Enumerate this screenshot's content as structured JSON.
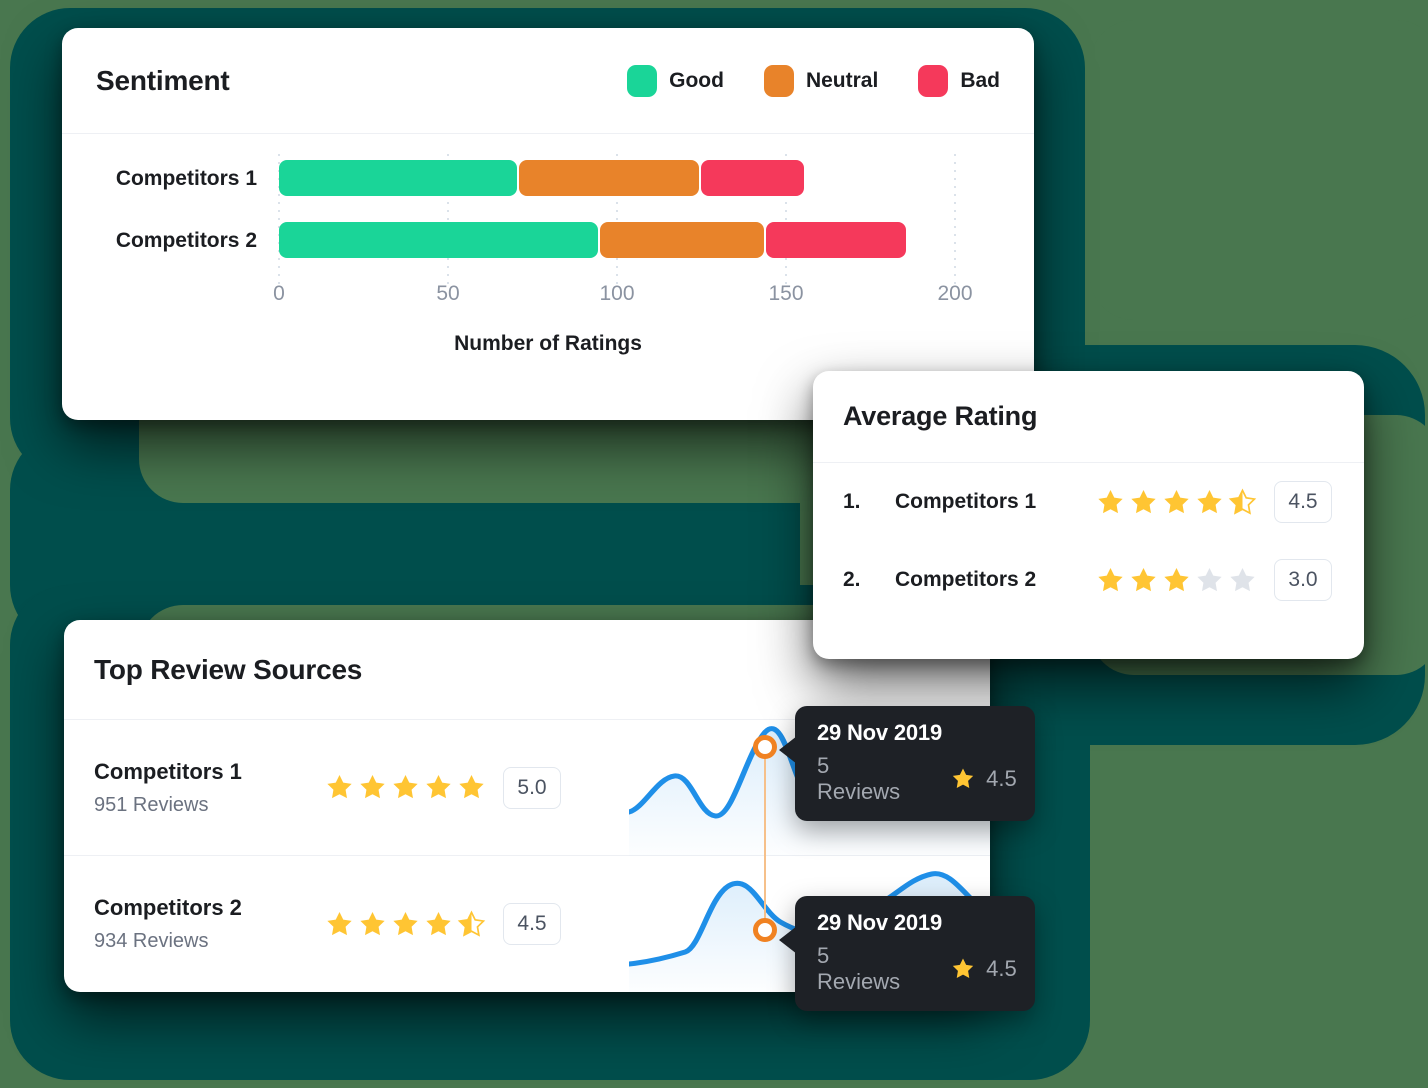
{
  "theme": {
    "accent_teal": "#004e4c",
    "background_green": "#49774f",
    "good_color": "#1ad598",
    "neutral_color": "#e8832a",
    "bad_color": "#f5395b",
    "star_color": "#ffc533",
    "star_empty_color": "#dfe3e9",
    "spark_color": "#1f8fe8",
    "marker_color": "#f08222"
  },
  "sentiment": {
    "title": "Sentiment",
    "legend": [
      {
        "label": "Good",
        "color": "#1ad598",
        "icon": "legend-swatch"
      },
      {
        "label": "Neutral",
        "color": "#e8832a",
        "icon": "legend-swatch"
      },
      {
        "label": "Bad",
        "color": "#f5395b",
        "icon": "legend-swatch"
      }
    ]
  },
  "chart_data": {
    "type": "bar",
    "orientation": "horizontal",
    "stacked": true,
    "title": "Sentiment",
    "xlabel": "Number of Ratings",
    "ylabel": "",
    "categories": [
      "Competitors 1",
      "Competitors 2"
    ],
    "series": [
      {
        "name": "Good",
        "color": "#1ad598",
        "values": [
          71,
          95
        ]
      },
      {
        "name": "Neutral",
        "color": "#e8832a",
        "values": [
          54,
          49
        ]
      },
      {
        "name": "Bad",
        "color": "#f5395b",
        "values": [
          31,
          42
        ]
      }
    ],
    "totals": [
      156,
      186
    ],
    "xlim": [
      0,
      200
    ],
    "xticks": [
      0,
      50,
      100,
      150,
      200
    ],
    "xtick_labels": [
      "0",
      "50",
      "100",
      "150",
      "200"
    ],
    "grid": "dotted-vertical",
    "legend_position": "top-right"
  },
  "average_rating": {
    "title": "Average Rating",
    "rows": [
      {
        "rank": "1.",
        "name": "Competitors 1",
        "stars": 4.5,
        "score": "4.5"
      },
      {
        "rank": "2.",
        "name": "Competitors 2",
        "stars": 3.0,
        "score": "3.0"
      }
    ]
  },
  "top_review_sources": {
    "title": "Top Review Sources",
    "rows": [
      {
        "name": "Competitors 1",
        "reviews": "951 Reviews",
        "stars": 5.0,
        "score": "5.0"
      },
      {
        "name": "Competitors 2",
        "reviews": "934 Reviews",
        "stars": 4.5,
        "score": "4.5"
      }
    ]
  },
  "tooltips": [
    {
      "date": "29 Nov 2019",
      "reviews": "5 Reviews",
      "rating": "4.5",
      "star_icon": "star-icon"
    },
    {
      "date": "29 Nov 2019",
      "reviews": "5 Reviews",
      "rating": "4.5",
      "star_icon": "star-icon"
    }
  ]
}
